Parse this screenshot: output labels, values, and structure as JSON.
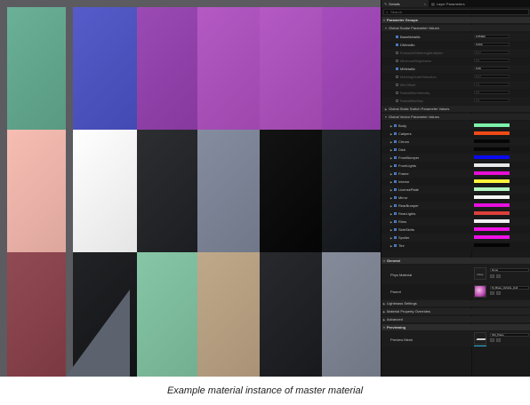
{
  "caption": "Example material instance of master material",
  "preview": {
    "tiles": [
      {
        "color": "#62ab91"
      },
      {
        "color": "#4b52c6"
      },
      {
        "color": "#953fb0"
      },
      {
        "color": "#b04fc0"
      },
      {
        "color": "#b04fc0"
      },
      {
        "color": "#a042b8"
      },
      {
        "color": "#f6b9ae"
      },
      {
        "color": "#ffffff"
      },
      {
        "color": "#1f2124"
      },
      {
        "color": "#7d8599"
      },
      {
        "color": "#050505"
      },
      {
        "color": "#15181d"
      },
      {
        "color": "#8a3f48"
      },
      {
        "color": "#141518"
      },
      {
        "color": "#7fc3a1"
      },
      {
        "color": "#bca383"
      },
      {
        "color": "#1a1c20"
      },
      {
        "color": "#7e8494"
      }
    ]
  },
  "details": {
    "tabs": [
      {
        "label": "Details",
        "icon": "pencil-icon"
      },
      {
        "label": "Layer Parameters",
        "icon": "layers-icon"
      }
    ],
    "search_placeholder": "Search",
    "parameter_groups_label": "Parameter Groups",
    "scalar_group_label": "Global Scalar Parameter Values",
    "scalar_params": [
      {
        "name": "BaseMetallic",
        "value": "0.55000",
        "enabled": true
      },
      {
        "name": "DMetallic",
        "value": "0.002",
        "enabled": true
      },
      {
        "name": "EmissiveDitheringMultiplier",
        "value": "10.0",
        "enabled": false
      },
      {
        "name": "MinimumBrightness",
        "value": "0.0",
        "enabled": false
      },
      {
        "name": "MMetallic",
        "value": "0.06",
        "enabled": true
      },
      {
        "name": "MarkingScaleSelection",
        "value": "10.0",
        "enabled": false
      },
      {
        "name": "MinOffset",
        "value": "1.0",
        "enabled": false
      },
      {
        "name": "RadialBlurIntensity",
        "value": "0.0",
        "enabled": false
      },
      {
        "name": "RadialBlurMax",
        "value": "0.0",
        "enabled": false
      }
    ],
    "static_switch_label": "Global Static Switch Parameter Values",
    "vector_group_label": "Global Vector Parameter Values",
    "vector_params": [
      {
        "name": "Body",
        "color": "#7ef1aa"
      },
      {
        "name": "Calipers",
        "color": "#f04a17"
      },
      {
        "name": "Chrom",
        "color": "#060606"
      },
      {
        "name": "Dish",
        "color": "#060606"
      },
      {
        "name": "FrontBumper",
        "color": "#0a0bf0"
      },
      {
        "name": "FrontLights",
        "color": "#e8e8ea"
      },
      {
        "name": "Frame",
        "color": "#e60ed4"
      },
      {
        "name": "Interior",
        "color": "#fff23a"
      },
      {
        "name": "LicensePlate",
        "color": "#b2f7c0"
      },
      {
        "name": "Mirror",
        "color": "#f6f6f6"
      },
      {
        "name": "RearBumper",
        "color": "#e810df"
      },
      {
        "name": "RearLights",
        "color": "#dd3f3a"
      },
      {
        "name": "Rims",
        "color": "#f2eef2"
      },
      {
        "name": "SideSkirts",
        "color": "#f011e6"
      },
      {
        "name": "Spoiler",
        "color": "#f011e6"
      },
      {
        "name": "Tire",
        "color": "#040404"
      }
    ],
    "general_label": "General",
    "phys_material_label": "Phys Material",
    "phys_material_value": "None",
    "phys_thumb_label": "None",
    "parent_label": "Parent",
    "parent_value": "M_Base_Vehicle_Hull",
    "lightmass_label": "Lightmass Settings",
    "overrides_label": "Material Property Overrides",
    "advanced_label": "Advanced",
    "previewing_label": "Previewing",
    "preview_mesh_label": "Preview Mesh",
    "preview_mesh_value": "SM_Plane"
  }
}
